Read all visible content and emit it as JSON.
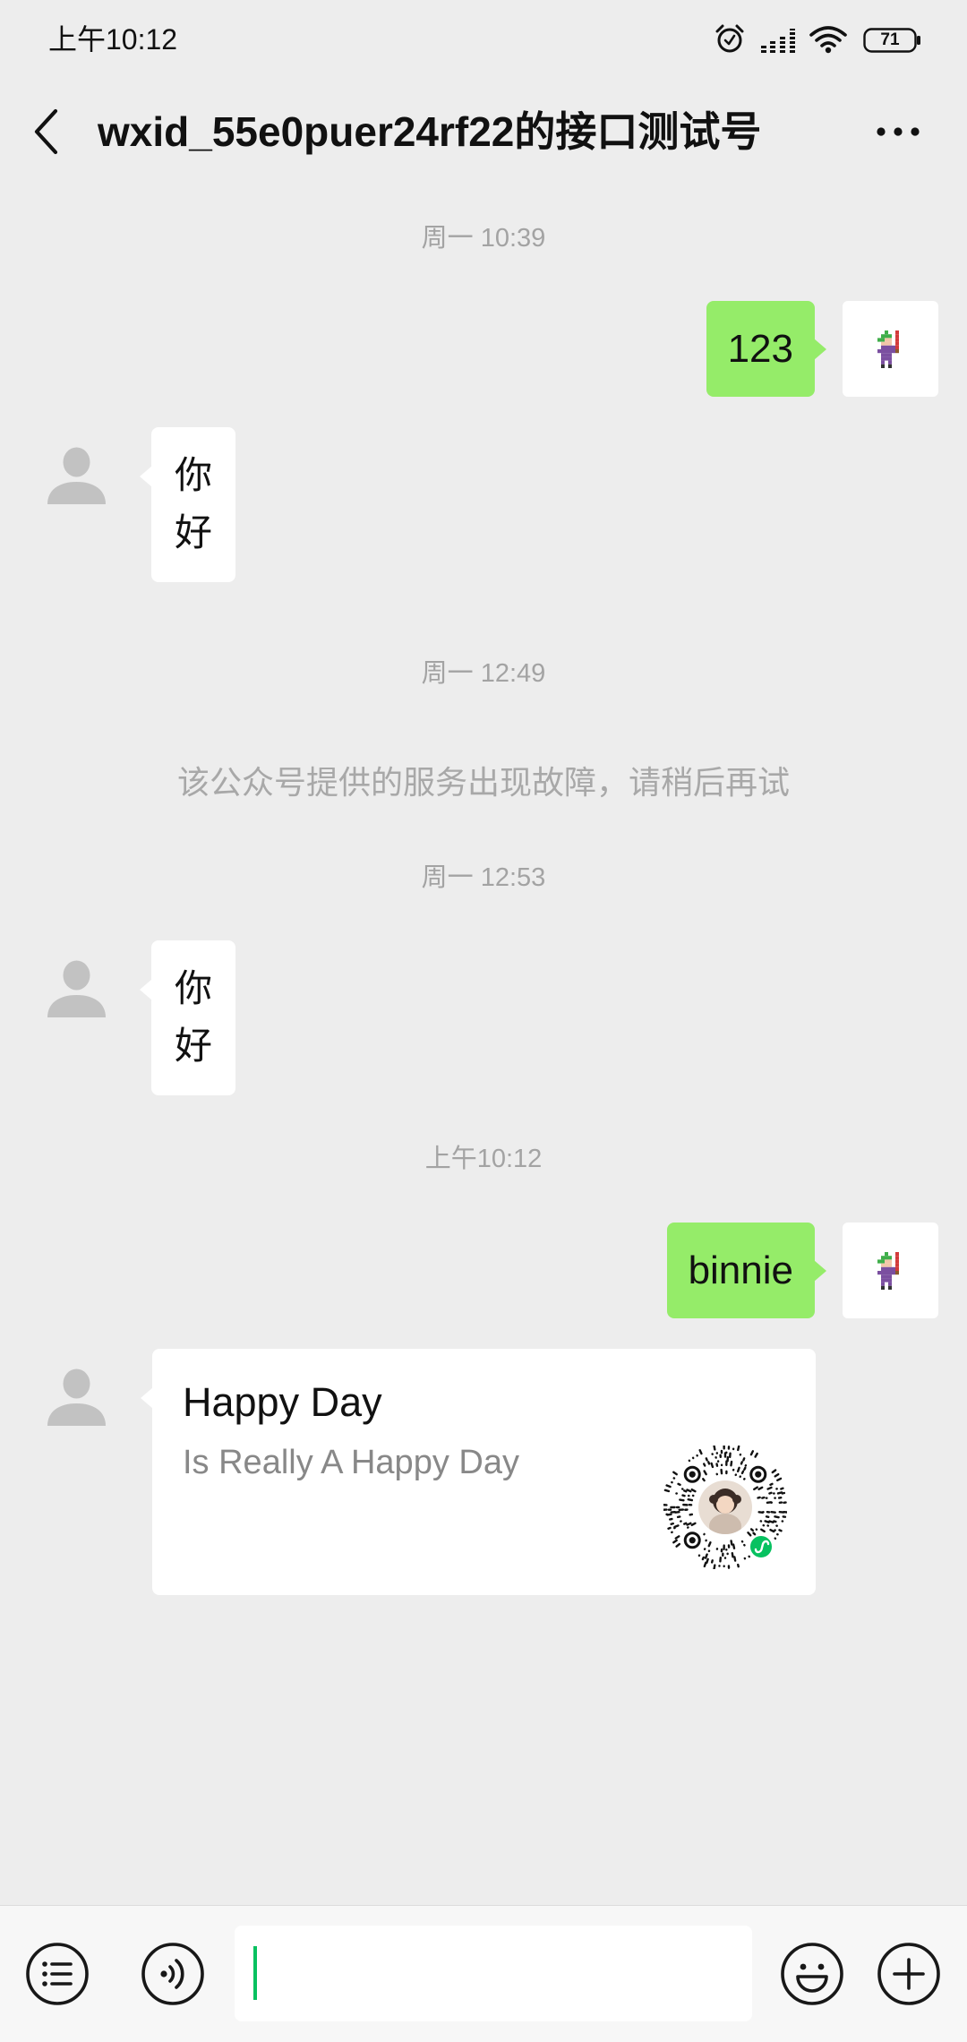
{
  "status_bar": {
    "time": "上午10:12",
    "battery": "71"
  },
  "header": {
    "title": "wxid_55e0puer24rf22的接口测试号"
  },
  "chat": [
    {
      "timestamp": "周一 10:39"
    },
    {
      "sent": "123"
    },
    {
      "received": "你好"
    },
    {
      "timestamp": "周一 12:49"
    },
    {
      "system": "该公众号提供的服务出现故障，请稍后再试"
    },
    {
      "timestamp": "周一 12:53"
    },
    {
      "received": "你好"
    },
    {
      "timestamp": "上午10:12"
    },
    {
      "sent": "binnie"
    },
    {
      "card": {
        "title": "Happy Day",
        "description": "Is Really A Happy Day"
      }
    }
  ],
  "input_bar": {
    "value": ""
  },
  "icons": {
    "alarm": "alarm-clock-icon",
    "signal": "signal-icon",
    "wifi": "wifi-icon",
    "battery": "battery-icon",
    "back": "chevron-left-icon",
    "more": "more-dots-icon",
    "sent_avatar": "pixel-character-avatar",
    "received_avatar": "default-person-icon",
    "card_code": "mini-program-code",
    "menu": "list-menu-icon",
    "voice": "voice-icon",
    "emoji": "emoji-icon",
    "plus": "plus-icon"
  },
  "colors": {
    "background": "#ededed",
    "sent_bubble": "#95ec69",
    "received_bubble": "#ffffff",
    "accent": "#07c160",
    "muted_text": "#a3a3a3",
    "input_bar": "#f7f7f7"
  }
}
